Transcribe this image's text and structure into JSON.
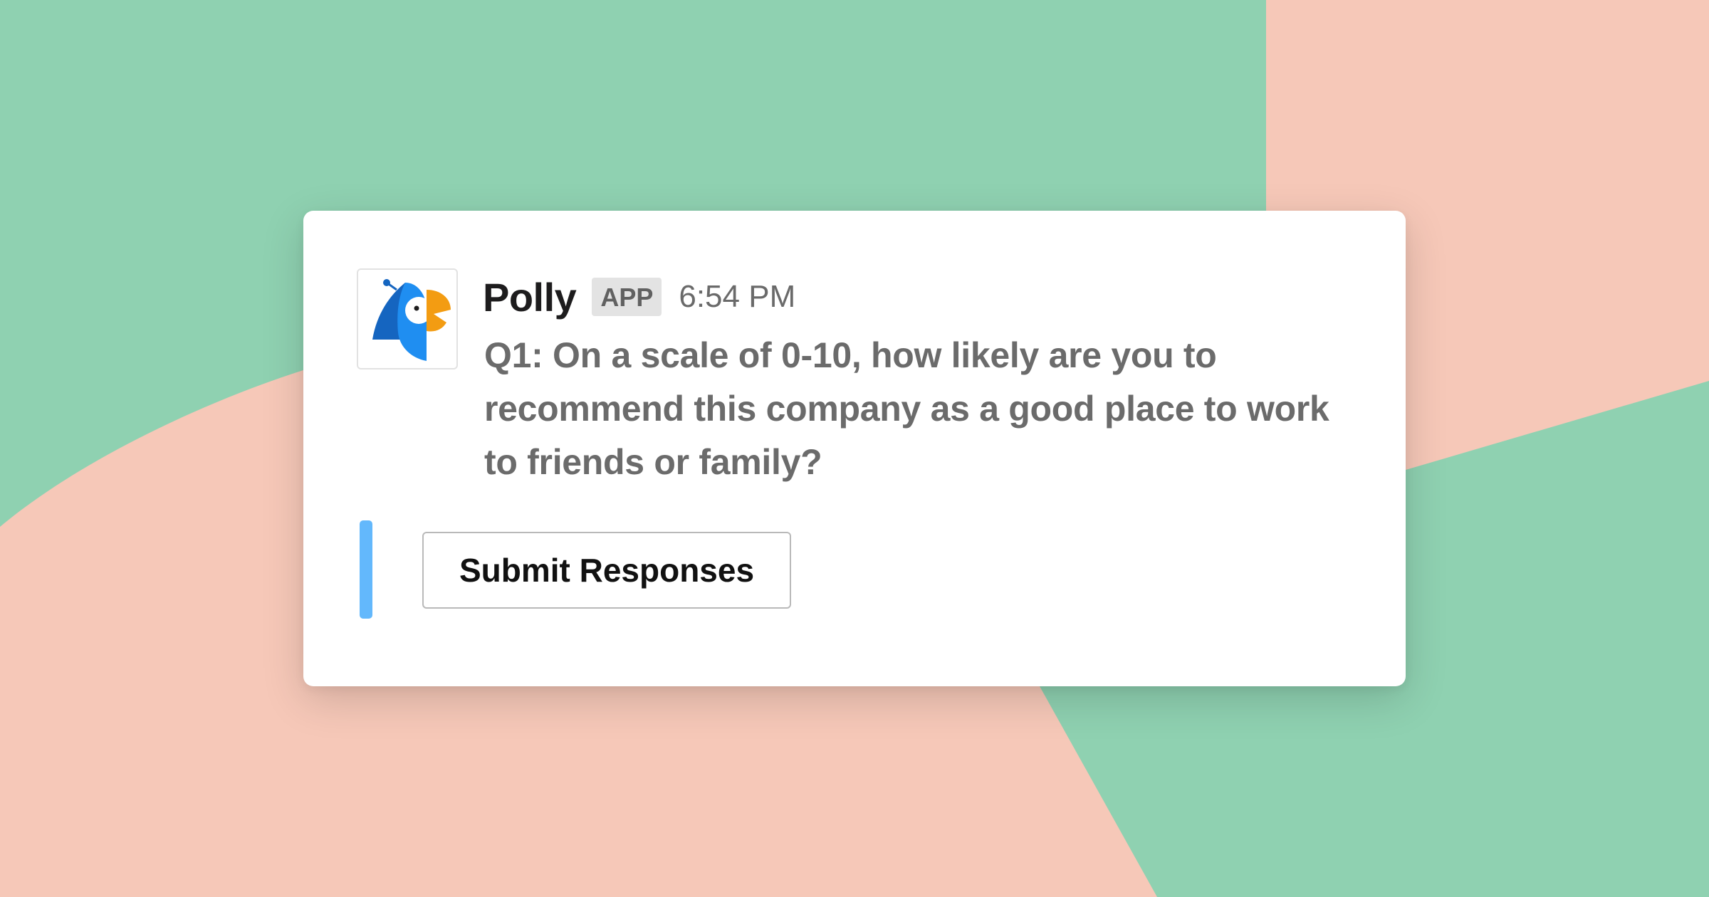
{
  "colors": {
    "background_green": "#8fd1b1",
    "background_peach": "#f6c8b8",
    "card": "#ffffff",
    "accent_bar": "#63b8fc",
    "logo_blue": "#1f8ef1",
    "logo_dark_blue": "#1565c0",
    "logo_orange": "#f39c12"
  },
  "message": {
    "avatar_icon": "polly-parrot-logo-icon",
    "sender": "Polly",
    "badge": "APP",
    "timestamp": "6:54 PM",
    "text": "Q1: On a scale of 0-10, how likely are you to recommend this company as a good place to work to friends or family?"
  },
  "actions": {
    "submit_label": "Submit Responses"
  }
}
